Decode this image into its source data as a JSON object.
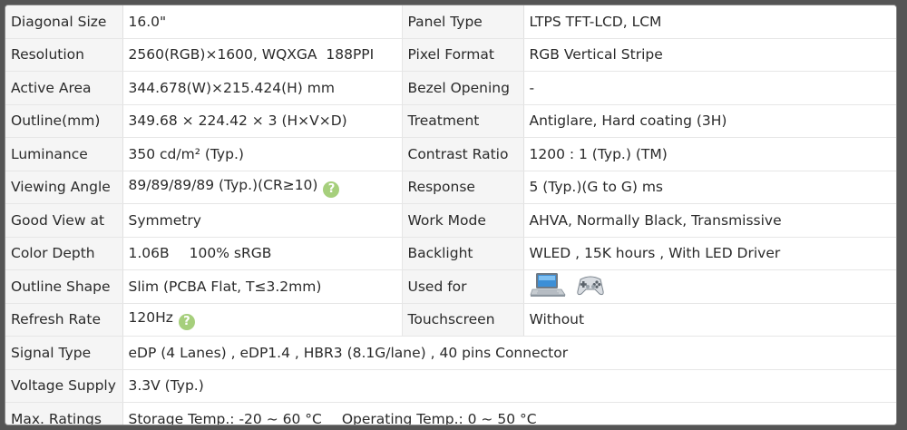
{
  "rows": [
    {
      "l1": "Diagonal Size",
      "v1": "16.0\"",
      "l2": "Panel Type",
      "v2": "LTPS TFT-LCD, LCM"
    },
    {
      "l1": "Resolution",
      "v1": "2560(RGB)×1600, WQXGA  188PPI",
      "l2": "Pixel Format",
      "v2": "RGB Vertical Stripe"
    },
    {
      "l1": "Active Area",
      "v1": "344.678(W)×215.424(H) mm",
      "l2": "Bezel Opening",
      "v2": "-"
    },
    {
      "l1": "Outline(mm)",
      "v1": "349.68 × 224.42 × 3 (H×V×D)",
      "l2": "Treatment",
      "v2": "Antiglare, Hard coating (3H)"
    },
    {
      "l1": "Luminance",
      "v1": "350 cd/m² (Typ.)",
      "l2": "Contrast Ratio",
      "v2": "1200 : 1 (Typ.) (TM)"
    },
    {
      "l1": "Viewing Angle",
      "v1": "89/89/89/89 (Typ.)(CR≥10)",
      "l2": "Response",
      "v2": "5 (Typ.)(G to G) ms"
    },
    {
      "l1": "Good View at",
      "v1": "Symmetry",
      "l2": "Work Mode",
      "v2": "AHVA, Normally Black, Transmissive"
    },
    {
      "l1": "Color Depth",
      "v1a": "1.06B",
      "v1b": "100% sRGB",
      "l2": "Backlight",
      "v2": "WLED , 15K hours , With LED Driver"
    },
    {
      "l1": "Outline Shape",
      "v1": "Slim (PCBA Flat, T≤3.2mm)",
      "l2": "Used for",
      "v2_icons": [
        "laptop-icon",
        "gamepad-icon"
      ]
    },
    {
      "l1": "Refresh Rate",
      "v1": "120Hz",
      "l2": "Touchscreen",
      "v2": "Without"
    },
    {
      "l1": "Signal Type",
      "v1": "eDP (4 Lanes) , eDP1.4 , HBR3 (8.1G/lane) , 40 pins Connector"
    },
    {
      "l1": "Voltage Supply",
      "v1": "3.3V (Typ.)"
    },
    {
      "l1": "Max. Ratings",
      "v1a": "Storage Temp.: -20 ~ 60 °C",
      "v1b": "Operating Temp.: 0 ~ 50 °C"
    }
  ],
  "help_glyph": "?",
  "colors": {
    "help_badge": "#a6cf7c",
    "label_bg": "#f5f5f5"
  }
}
